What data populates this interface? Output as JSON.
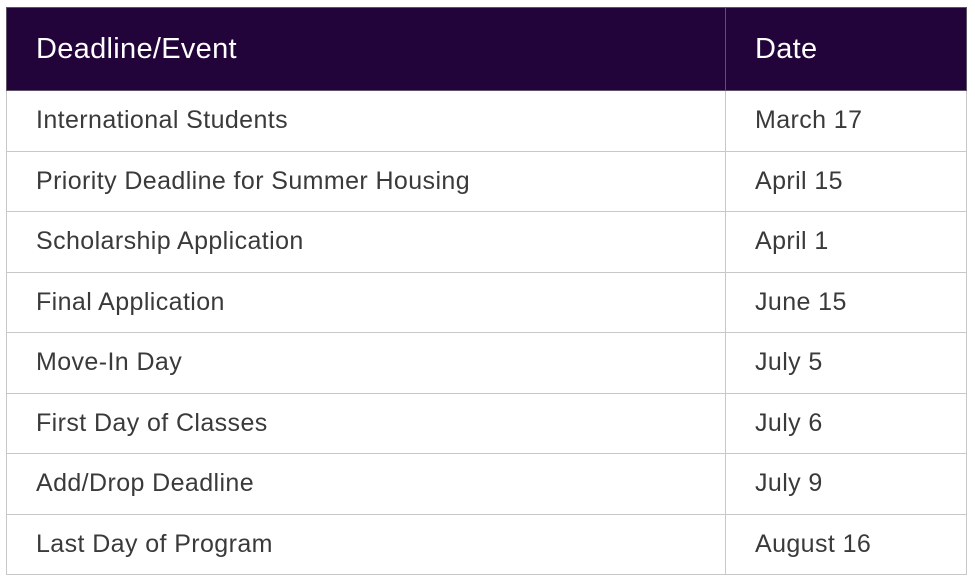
{
  "table": {
    "header_bg": "#23043a",
    "columns": [
      "Deadline/Event",
      "Date"
    ],
    "rows": [
      {
        "event": "International Students",
        "date": "March 17"
      },
      {
        "event": "Priority Deadline for Summer Housing",
        "date": "April 15"
      },
      {
        "event": "Scholarship Application",
        "date": "April 1"
      },
      {
        "event": "Final Application",
        "date": "June 15"
      },
      {
        "event": "Move-In Day",
        "date": "July 5"
      },
      {
        "event": "First Day of Classes",
        "date": "July 6"
      },
      {
        "event": "Add/Drop Deadline",
        "date": "July 9"
      },
      {
        "event": "Last Day of Program",
        "date": "August 16"
      }
    ]
  }
}
